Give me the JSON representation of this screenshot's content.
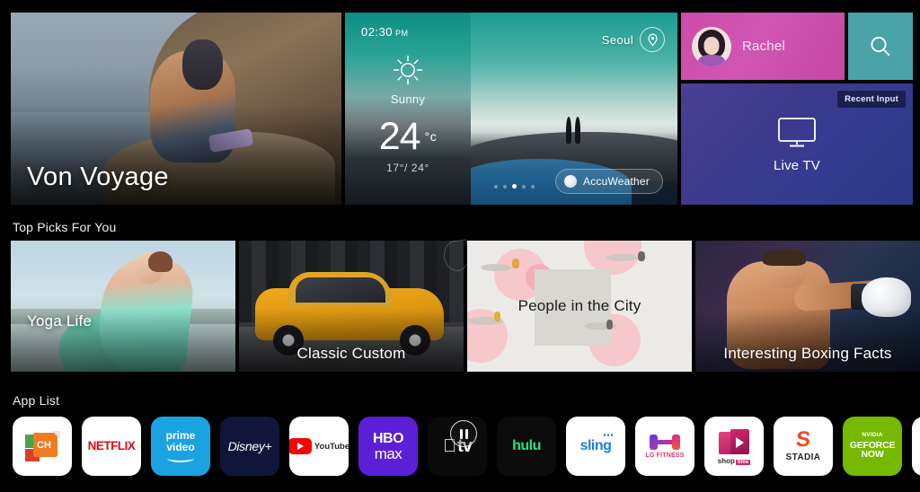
{
  "hero": {
    "title": "Von Voyage",
    "name": "hero-banner"
  },
  "weather": {
    "time": "02:30",
    "ampm": "PM",
    "condition": "Sunny",
    "temperature": "24",
    "unit": "°c",
    "range": "17°/ 24°",
    "location": "Seoul",
    "provider": "AccuWeather",
    "pin_icon": "location-pin-icon",
    "sun_icon": "sun-icon",
    "dots": 5,
    "active_dot": 2
  },
  "profile": {
    "name": "Rachel",
    "avatar_icon": "user-avatar"
  },
  "search": {
    "icon": "search-icon",
    "label": "Search"
  },
  "live_tv": {
    "label": "Live TV",
    "badge": "Recent Input",
    "icon": "tv-monitor-icon"
  },
  "sections": {
    "top_picks": "Top Picks For You",
    "app_list": "App List"
  },
  "top_picks": [
    {
      "title": "Yoga Life",
      "title_pos": "left-bottom",
      "theme": "yoga"
    },
    {
      "title": "Classic Custom",
      "title_pos": "center-bottom",
      "theme": "car"
    },
    {
      "title": "People in the City",
      "title_pos": "center",
      "theme": "city"
    },
    {
      "title": "Interesting Boxing Facts",
      "title_pos": "center-bottom",
      "theme": "boxing"
    }
  ],
  "apps": [
    {
      "name": "CH",
      "id": "channel-app"
    },
    {
      "name": "NETFLIX",
      "id": "netflix"
    },
    {
      "name": "prime video",
      "id": "prime-video",
      "line1": "prime",
      "line2": "video"
    },
    {
      "name": "Disney+",
      "id": "disney-plus"
    },
    {
      "name": "YouTube",
      "id": "youtube"
    },
    {
      "name": "HBO max",
      "id": "hbo-max",
      "line1": "HBO",
      "line2": "max"
    },
    {
      "name": "Apple TV",
      "id": "apple-tv",
      "line1": "",
      "line2": "tv"
    },
    {
      "name": "hulu",
      "id": "hulu"
    },
    {
      "name": "sling",
      "id": "sling"
    },
    {
      "name": "LG FITNESS",
      "id": "lg-fitness"
    },
    {
      "name": "shop time",
      "id": "shop-time",
      "line1": "shop",
      "line2": "time"
    },
    {
      "name": "STADIA",
      "id": "stadia",
      "line1": "S",
      "line2": "STADIA"
    },
    {
      "name": "NVIDIA GEFORCE NOW",
      "id": "geforce-now",
      "line1": "NVIDIA",
      "line2": "GEFORCE",
      "line3": "NOW"
    }
  ],
  "colors": {
    "background": "#010101",
    "profile_pink": "#cf4aa8",
    "search_teal": "#4aa3a6",
    "livetv_purple": "#3d3a8c",
    "weather_teal": "#1c9c92",
    "netflix_red": "#e50914",
    "prime_blue": "#1aa3e0",
    "disney_navy": "#10163a",
    "hbo_purple": "#5b1fd6",
    "hulu_green": "#1ce783",
    "sling_blue": "#1b7fd4",
    "stadia_orange": "#f4471f",
    "nvidia_green": "#76b900"
  },
  "cursor": {
    "type": "pause-cursor",
    "secondary": "drop-cursor"
  }
}
